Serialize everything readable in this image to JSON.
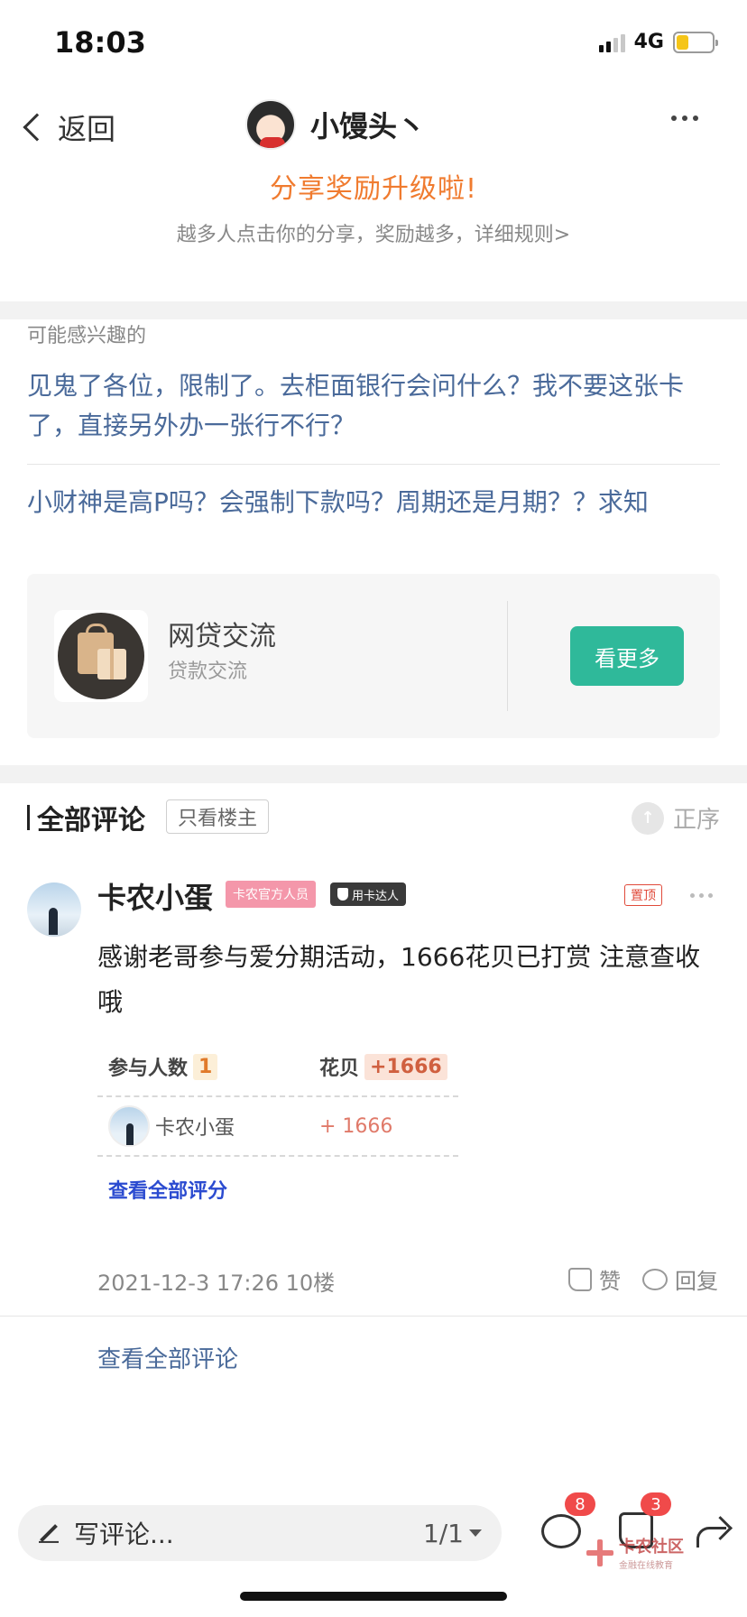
{
  "status_bar": {
    "time": "18:03",
    "network": "4G",
    "battery_level": 0.35
  },
  "header": {
    "back_label": "返回",
    "author_name": "小馒头丶"
  },
  "promo": {
    "title": "分享奖励升级啦!",
    "subtitle": "越多人点击你的分享，奖励越多，详细规则>"
  },
  "interest": {
    "label": "可能感兴趣的",
    "items": [
      "见鬼了各位，限制了。去柜面银行会问什么？我不要这张卡了，直接另外办一张行不行？",
      "小财神是高P吗？会强制下款吗？周期还是月期？？求知"
    ]
  },
  "forum_card": {
    "title": "网贷交流",
    "subtitle": "贷款交流",
    "button_label": "看更多"
  },
  "comments": {
    "title": "全部评论",
    "only_op_label": "只看楼主",
    "sort_icon": "↑",
    "sort_label": "正序"
  },
  "comment": {
    "author": "卡农小蛋",
    "badge_official": "卡农官方人员",
    "badge_expert": "用卡达人",
    "pinned_label": "置顶",
    "text": "感谢老哥参与爱分期活动，1666花贝已打赏  注意查收哦",
    "reward": {
      "participants_label": "参与人数",
      "participants_count": "1",
      "huabei_label": "花贝",
      "huabei_total": "+1666",
      "user_name": "卡农小蛋",
      "user_amount": "+ 1666",
      "view_all_label": "查看全部评分"
    },
    "timestamp": "2021-12-3 17:26",
    "floor": "10楼",
    "like_label": "赞",
    "reply_label": "回复"
  },
  "view_all_comments": "查看全部评论",
  "bottom_bar": {
    "input_placeholder": "写评论...",
    "page_indicator": "1/1",
    "comment_count": "8",
    "like_count": "3"
  },
  "watermark": {
    "title": "卡农社区",
    "subtitle": "金融在线教育"
  },
  "colors": {
    "accent_orange": "#f07b2f",
    "link_blue": "#4a6a9a",
    "button_green": "#2fb99a",
    "badge_red": "#f04a4a"
  }
}
